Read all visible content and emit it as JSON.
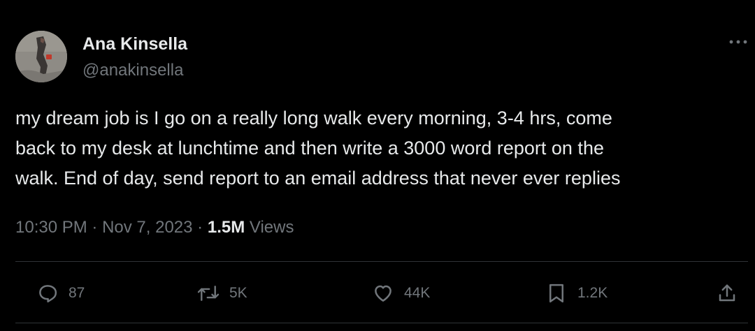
{
  "author": {
    "name": "Ana Kinsella",
    "handle": "@anakinsella"
  },
  "tweet": {
    "lines": [
      "my dream job is I go on a really long walk every morning, 3-4 hrs, come",
      "back to my desk at lunchtime and then write a 3000 word report on the",
      "walk. End of day, send report to an email address that never ever replies"
    ],
    "time": "10:30 PM",
    "date": "Nov 7, 2023",
    "views_count": "1.5M",
    "views_label": "Views"
  },
  "actions": {
    "replies": "87",
    "reposts": "5K",
    "likes": "44K",
    "bookmarks": "1.2K"
  },
  "icons": {
    "more": "more-horizontal-icon",
    "reply": "reply-icon",
    "repost": "repost-icon",
    "like": "heart-icon",
    "bookmark": "bookmark-icon",
    "share": "share-icon"
  },
  "colors": {
    "background": "#000000",
    "text": "#e7e9ea",
    "secondary": "#71767b",
    "divider": "#2f3336"
  }
}
